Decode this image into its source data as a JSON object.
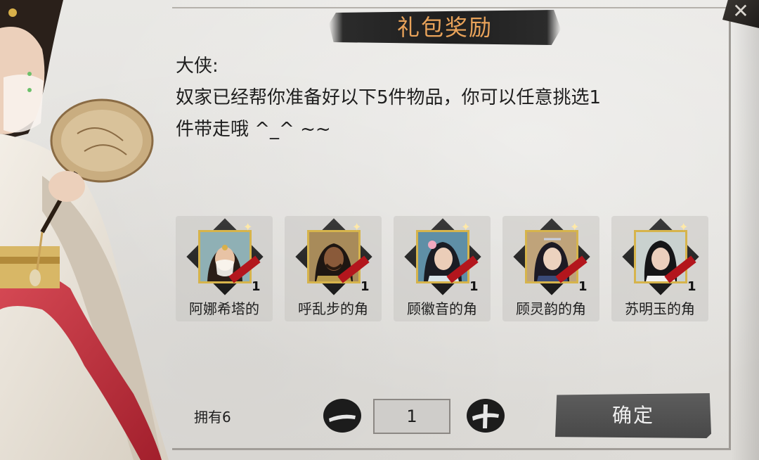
{
  "dialog": {
    "title": "礼包奖励",
    "close_icon": "close-icon"
  },
  "message": {
    "line1": "大侠:",
    "line2": "奴家已经帮你准备好以下5件物品，你可以任意挑选1",
    "line3": "件带走哦  ^_^  ~~"
  },
  "items": [
    {
      "name": "阿娜希塔的",
      "qty": "1",
      "portrait_bg": "#8fb0b5",
      "skin": "#e8c3a5",
      "hair": "#2a1e18"
    },
    {
      "name": "呼乱步的角",
      "qty": "1",
      "portrait_bg": "#a88b5a",
      "skin": "#8a5a3a",
      "hair": "#1e1612"
    },
    {
      "name": "顾徽音的角",
      "qty": "1",
      "portrait_bg": "#5f8fa6",
      "skin": "#ebcdb8",
      "hair": "#1a1c24"
    },
    {
      "name": "顾灵韵的角",
      "qty": "1",
      "portrait_bg": "#bfa37a",
      "skin": "#ecd2bf",
      "hair": "#1d1a24"
    },
    {
      "name": "苏明玉的角",
      "qty": "1",
      "portrait_bg": "#c9d1cf",
      "skin": "#ebcfbd",
      "hair": "#151517"
    }
  ],
  "footer": {
    "owned_label": "拥有6",
    "quantity_value": "1",
    "confirm_label": "确定"
  },
  "colors": {
    "title_text": "#e9a35a",
    "accent_red": "#b3161d",
    "frame_gold": "#d6b44c"
  }
}
